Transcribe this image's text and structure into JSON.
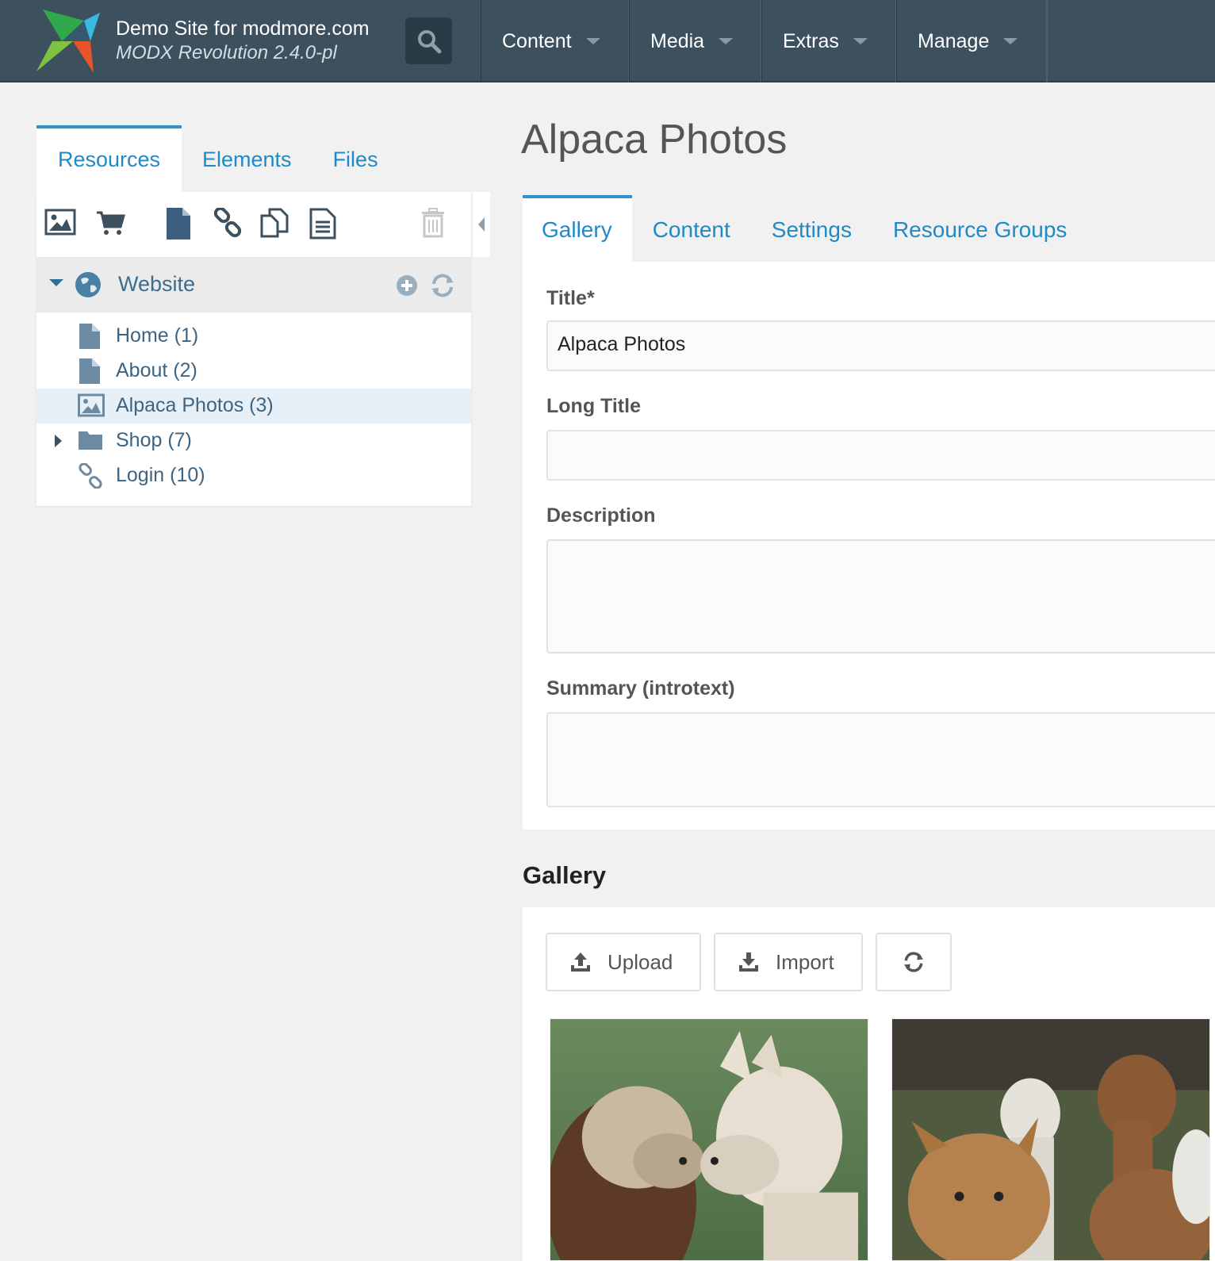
{
  "header": {
    "site_name": "Demo Site for modmore.com",
    "version": "MODX Revolution 2.4.0-pl",
    "nav": [
      "Content",
      "Media",
      "Extras",
      "Manage"
    ]
  },
  "left": {
    "tabs": [
      "Resources",
      "Elements",
      "Files"
    ],
    "toolbar_icons": [
      "new-gallery-icon",
      "new-product-icon",
      "new-document-icon",
      "new-weblink-icon",
      "new-symlink-icon",
      "new-static-resource-icon",
      "trash-icon"
    ],
    "tree": {
      "root": "Website",
      "items": [
        {
          "label": "Home (1)",
          "icon": "document-icon"
        },
        {
          "label": "About (2)",
          "icon": "document-icon"
        },
        {
          "label": "Alpaca Photos (3)",
          "icon": "image-icon",
          "selected": true
        },
        {
          "label": "Shop (7)",
          "icon": "folder-icon",
          "expandable": true
        },
        {
          "label": "Login (10)",
          "icon": "weblink-icon"
        }
      ]
    }
  },
  "main": {
    "title": "Alpaca Photos",
    "tabs": [
      "Gallery",
      "Content",
      "Settings",
      "Resource Groups"
    ],
    "form": {
      "title_label": "Title*",
      "title_value": "Alpaca Photos",
      "longtitle_label": "Long Title",
      "longtitle_value": "",
      "description_label": "Description",
      "description_value": "",
      "summary_label": "Summary (introtext)",
      "summary_value": ""
    },
    "gallery": {
      "heading": "Gallery",
      "upload_label": "Upload",
      "import_label": "Import"
    }
  },
  "colors": {
    "topbar": "#3c505d",
    "accent": "#2f91d2",
    "link": "#1f8ac7"
  }
}
